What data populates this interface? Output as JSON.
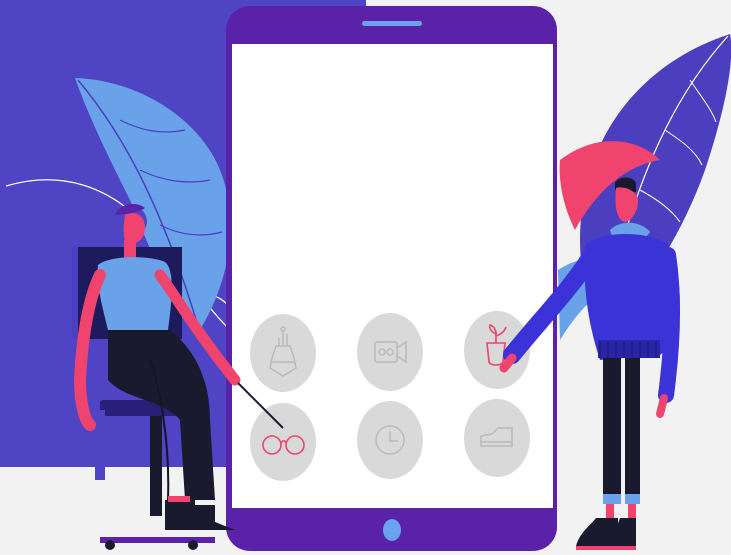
{
  "colors": {
    "background": "#f2f2f2",
    "panel": "#4f45c4",
    "phone_frame": "#5a22a8",
    "phone_screen": "#ffffff",
    "speaker": "#6aa2f0",
    "home_button": "#6aa2f0",
    "leaf_light": "#6aa2ea",
    "leaf_dark": "#4b3fc0",
    "accent_pink": "#f0446e",
    "icon_circle": "#d9d9d9",
    "icon_line": "#b9b9b9",
    "man_sweater": "#3b33d8",
    "woman_top": "#6aa2ea",
    "pants_dark": "#1a1a2e"
  },
  "app_grid": [
    {
      "icon": "vase-icon"
    },
    {
      "icon": "video-camera-icon"
    },
    {
      "icon": "plant-pot-icon"
    },
    {
      "icon": "glasses-icon"
    },
    {
      "icon": "clock-icon"
    },
    {
      "icon": "sneaker-icon"
    }
  ]
}
